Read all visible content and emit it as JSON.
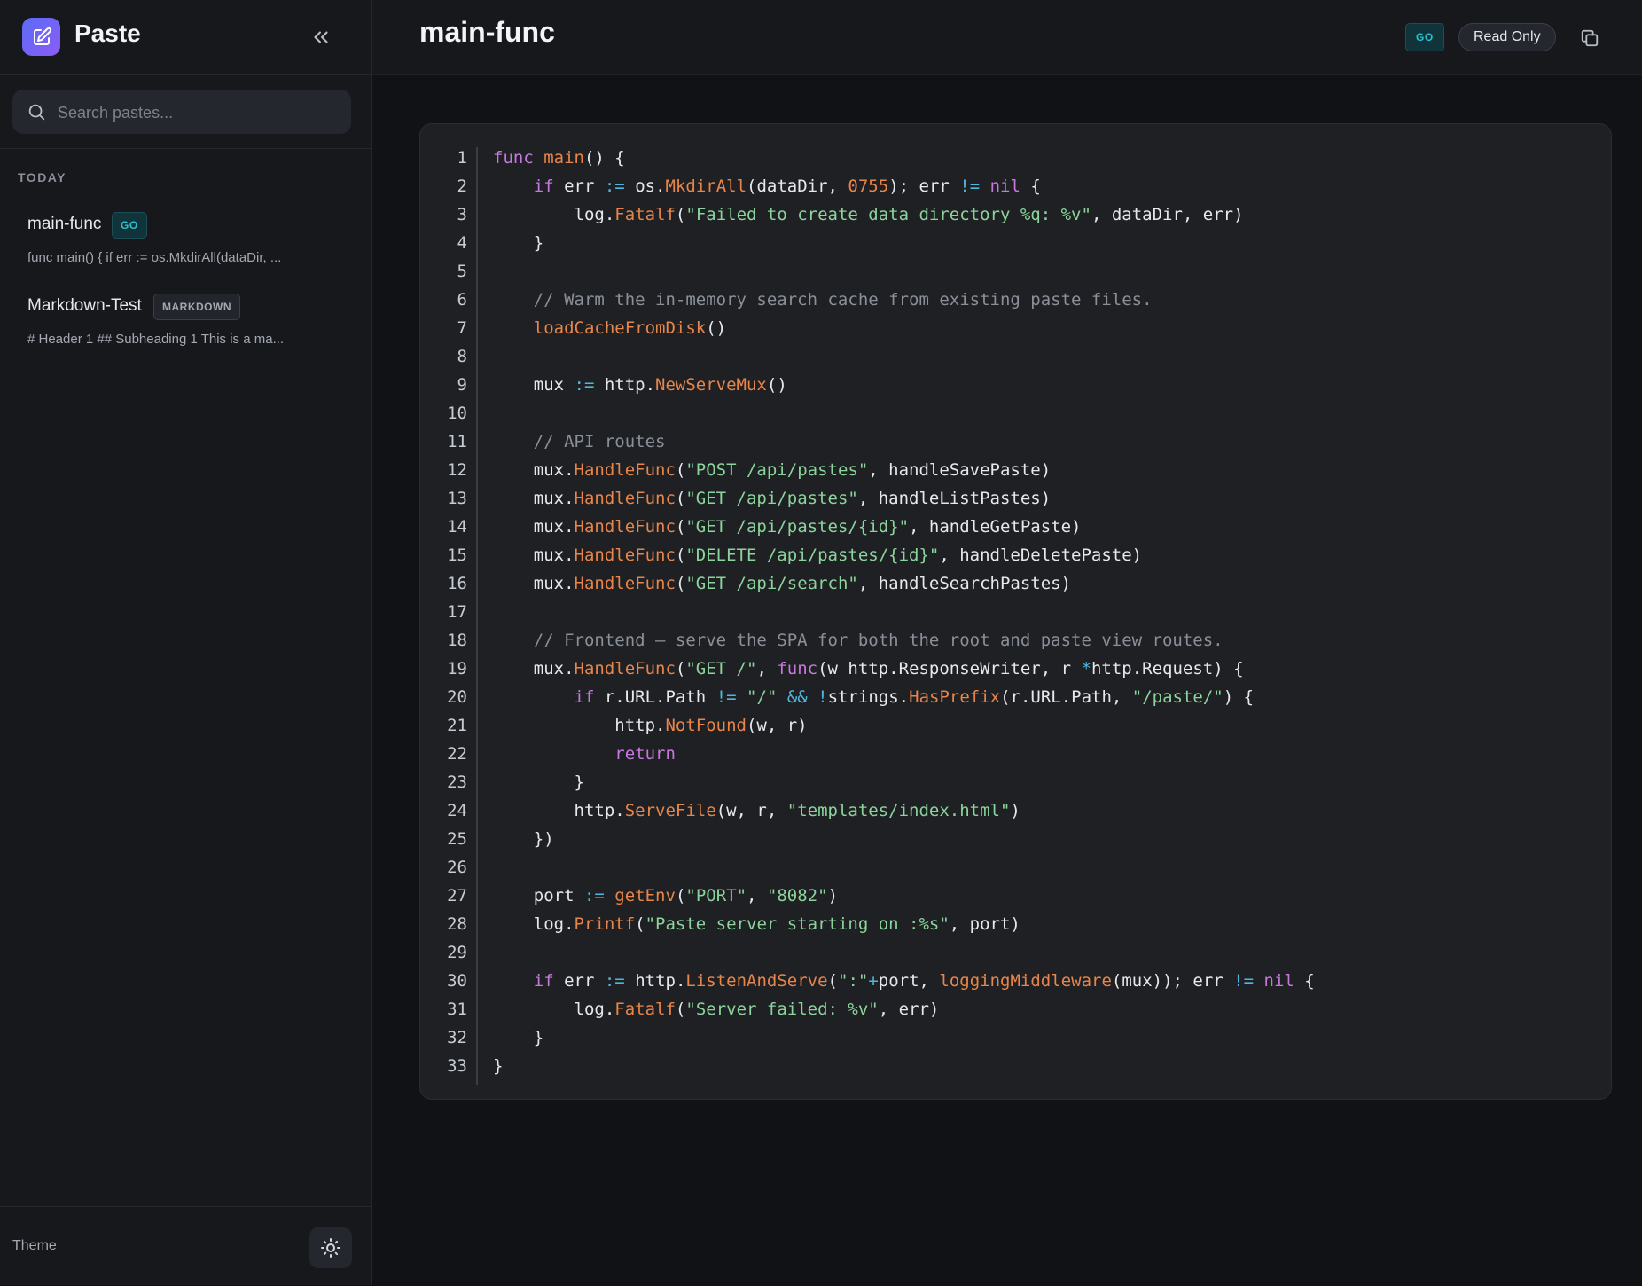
{
  "app": {
    "name": "Paste"
  },
  "search": {
    "placeholder": "Search pastes..."
  },
  "sidebar": {
    "section_label": "TODAY",
    "items": [
      {
        "title": "main-func",
        "badge": "GO",
        "preview": "func main() { if err := os.MkdirAll(dataDir, ..."
      },
      {
        "title": "Markdown-Test",
        "badge": "MARKDOWN",
        "preview": "# Header 1 ## Subheading 1 This is a ma..."
      }
    ],
    "theme_label": "Theme"
  },
  "header": {
    "title": "main-func",
    "language_badge": "GO",
    "readonly_label": "Read Only"
  },
  "colors": {
    "keyword": "#c678dd",
    "function": "#e8854a",
    "string": "#8bd49c",
    "operator": "#4fb6e0",
    "comment": "#8a9099",
    "text": "#e6e8eb",
    "accent": "#6366f1"
  },
  "code": {
    "language": "go",
    "lines": [
      [
        [
          "kw",
          "func"
        ],
        [
          "txt",
          " "
        ],
        [
          "fn",
          "main"
        ],
        [
          "txt",
          "() {"
        ]
      ],
      [
        [
          "txt",
          "    "
        ],
        [
          "kw",
          "if"
        ],
        [
          "txt",
          " err "
        ],
        [
          "op",
          ":="
        ],
        [
          "txt",
          " os."
        ],
        [
          "fn",
          "MkdirAll"
        ],
        [
          "txt",
          "(dataDir, "
        ],
        [
          "num",
          "0755"
        ],
        [
          "txt",
          "); err "
        ],
        [
          "op",
          "!="
        ],
        [
          "txt",
          " "
        ],
        [
          "kw",
          "nil"
        ],
        [
          "txt",
          " {"
        ]
      ],
      [
        [
          "txt",
          "        log."
        ],
        [
          "fn",
          "Fatalf"
        ],
        [
          "txt",
          "("
        ],
        [
          "str",
          "\"Failed to create data directory %q: %v\""
        ],
        [
          "txt",
          ", dataDir, err)"
        ]
      ],
      [
        [
          "txt",
          "    }"
        ]
      ],
      [
        [
          "txt",
          ""
        ]
      ],
      [
        [
          "txt",
          "    "
        ],
        [
          "cm",
          "// Warm the in-memory search cache from existing paste files."
        ]
      ],
      [
        [
          "txt",
          "    "
        ],
        [
          "fn",
          "loadCacheFromDisk"
        ],
        [
          "txt",
          "()"
        ]
      ],
      [
        [
          "txt",
          ""
        ]
      ],
      [
        [
          "txt",
          "    mux "
        ],
        [
          "op",
          ":="
        ],
        [
          "txt",
          " http."
        ],
        [
          "fn",
          "NewServeMux"
        ],
        [
          "txt",
          "()"
        ]
      ],
      [
        [
          "txt",
          ""
        ]
      ],
      [
        [
          "txt",
          "    "
        ],
        [
          "cm",
          "// API routes"
        ]
      ],
      [
        [
          "txt",
          "    mux."
        ],
        [
          "fn",
          "HandleFunc"
        ],
        [
          "txt",
          "("
        ],
        [
          "str",
          "\"POST /api/pastes\""
        ],
        [
          "txt",
          ", handleSavePaste)"
        ]
      ],
      [
        [
          "txt",
          "    mux."
        ],
        [
          "fn",
          "HandleFunc"
        ],
        [
          "txt",
          "("
        ],
        [
          "str",
          "\"GET /api/pastes\""
        ],
        [
          "txt",
          ", handleListPastes)"
        ]
      ],
      [
        [
          "txt",
          "    mux."
        ],
        [
          "fn",
          "HandleFunc"
        ],
        [
          "txt",
          "("
        ],
        [
          "str",
          "\"GET /api/pastes/{id}\""
        ],
        [
          "txt",
          ", handleGetPaste)"
        ]
      ],
      [
        [
          "txt",
          "    mux."
        ],
        [
          "fn",
          "HandleFunc"
        ],
        [
          "txt",
          "("
        ],
        [
          "str",
          "\"DELETE /api/pastes/{id}\""
        ],
        [
          "txt",
          ", handleDeletePaste)"
        ]
      ],
      [
        [
          "txt",
          "    mux."
        ],
        [
          "fn",
          "HandleFunc"
        ],
        [
          "txt",
          "("
        ],
        [
          "str",
          "\"GET /api/search\""
        ],
        [
          "txt",
          ", handleSearchPastes)"
        ]
      ],
      [
        [
          "txt",
          ""
        ]
      ],
      [
        [
          "txt",
          "    "
        ],
        [
          "cm",
          "// Frontend — serve the SPA for both the root and paste view routes."
        ]
      ],
      [
        [
          "txt",
          "    mux."
        ],
        [
          "fn",
          "HandleFunc"
        ],
        [
          "txt",
          "("
        ],
        [
          "str",
          "\"GET /\""
        ],
        [
          "txt",
          ", "
        ],
        [
          "kw",
          "func"
        ],
        [
          "txt",
          "(w http.ResponseWriter, r "
        ],
        [
          "op",
          "*"
        ],
        [
          "txt",
          "http.Request) {"
        ]
      ],
      [
        [
          "txt",
          "        "
        ],
        [
          "kw",
          "if"
        ],
        [
          "txt",
          " r.URL.Path "
        ],
        [
          "op",
          "!="
        ],
        [
          "txt",
          " "
        ],
        [
          "str",
          "\"/\""
        ],
        [
          "txt",
          " "
        ],
        [
          "op",
          "&&"
        ],
        [
          "txt",
          " "
        ],
        [
          "op",
          "!"
        ],
        [
          "txt",
          "strings."
        ],
        [
          "fn",
          "HasPrefix"
        ],
        [
          "txt",
          "(r.URL.Path, "
        ],
        [
          "str",
          "\"/paste/\""
        ],
        [
          "txt",
          ") {"
        ]
      ],
      [
        [
          "txt",
          "            http."
        ],
        [
          "fn",
          "NotFound"
        ],
        [
          "txt",
          "(w, r)"
        ]
      ],
      [
        [
          "txt",
          "            "
        ],
        [
          "kw",
          "return"
        ]
      ],
      [
        [
          "txt",
          "        }"
        ]
      ],
      [
        [
          "txt",
          "        http."
        ],
        [
          "fn",
          "ServeFile"
        ],
        [
          "txt",
          "(w, r, "
        ],
        [
          "str",
          "\"templates/index.html\""
        ],
        [
          "txt",
          ")"
        ]
      ],
      [
        [
          "txt",
          "    })"
        ]
      ],
      [
        [
          "txt",
          ""
        ]
      ],
      [
        [
          "txt",
          "    port "
        ],
        [
          "op",
          ":="
        ],
        [
          "txt",
          " "
        ],
        [
          "fn",
          "getEnv"
        ],
        [
          "txt",
          "("
        ],
        [
          "str",
          "\"PORT\""
        ],
        [
          "txt",
          ", "
        ],
        [
          "str",
          "\"8082\""
        ],
        [
          "txt",
          ")"
        ]
      ],
      [
        [
          "txt",
          "    log."
        ],
        [
          "fn",
          "Printf"
        ],
        [
          "txt",
          "("
        ],
        [
          "str",
          "\"Paste server starting on :%s\""
        ],
        [
          "txt",
          ", port)"
        ]
      ],
      [
        [
          "txt",
          ""
        ]
      ],
      [
        [
          "txt",
          "    "
        ],
        [
          "kw",
          "if"
        ],
        [
          "txt",
          " err "
        ],
        [
          "op",
          ":="
        ],
        [
          "txt",
          " http."
        ],
        [
          "fn",
          "ListenAndServe"
        ],
        [
          "txt",
          "("
        ],
        [
          "str",
          "\":\""
        ],
        [
          "op",
          "+"
        ],
        [
          "txt",
          "port, "
        ],
        [
          "fn",
          "loggingMiddleware"
        ],
        [
          "txt",
          "(mux)); err "
        ],
        [
          "op",
          "!="
        ],
        [
          "txt",
          " "
        ],
        [
          "kw",
          "nil"
        ],
        [
          "txt",
          " {"
        ]
      ],
      [
        [
          "txt",
          "        log."
        ],
        [
          "fn",
          "Fatalf"
        ],
        [
          "txt",
          "("
        ],
        [
          "str",
          "\"Server failed: %v\""
        ],
        [
          "txt",
          ", err)"
        ]
      ],
      [
        [
          "txt",
          "    }"
        ]
      ],
      [
        [
          "txt",
          "}"
        ]
      ]
    ]
  }
}
